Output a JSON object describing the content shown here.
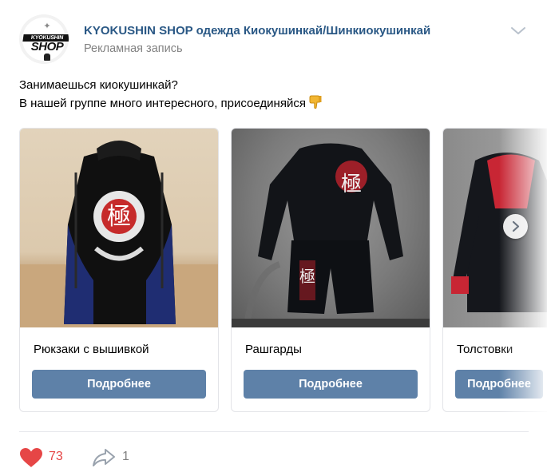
{
  "post": {
    "group_name": "KYOKUSHIN SHOP одежда Киокушинкай/Шинкиокушинкай",
    "ad_label": "Рекламная запись",
    "avatar": {
      "logo_top": "KYOKUSHIN",
      "logo_bottom": "SHOP"
    },
    "text_line_1": "Занимаешься киокушинкай?",
    "text_line_2": "В нашей группе много интересного, присоединяйся",
    "menu_icon": "chevron-down-icon"
  },
  "carousel": {
    "cards": [
      {
        "title": "Рюкзаки с вышивкой",
        "button_label": "Подробнее",
        "image": "backpack-photo"
      },
      {
        "title": "Рашгарды",
        "button_label": "Подробнее",
        "image": "rashguard-photo"
      },
      {
        "title": "Толстовки",
        "button_label": "Подробнее",
        "image": "hoodie-photo"
      }
    ],
    "next_icon": "chevron-right-icon"
  },
  "footer": {
    "likes": "73",
    "shares": "1",
    "like_icon": "heart-icon",
    "share_icon": "share-arrow-icon"
  },
  "colors": {
    "link": "#2a5885",
    "button": "#5e81a8",
    "like": "#e64646",
    "muted": "#828282"
  }
}
